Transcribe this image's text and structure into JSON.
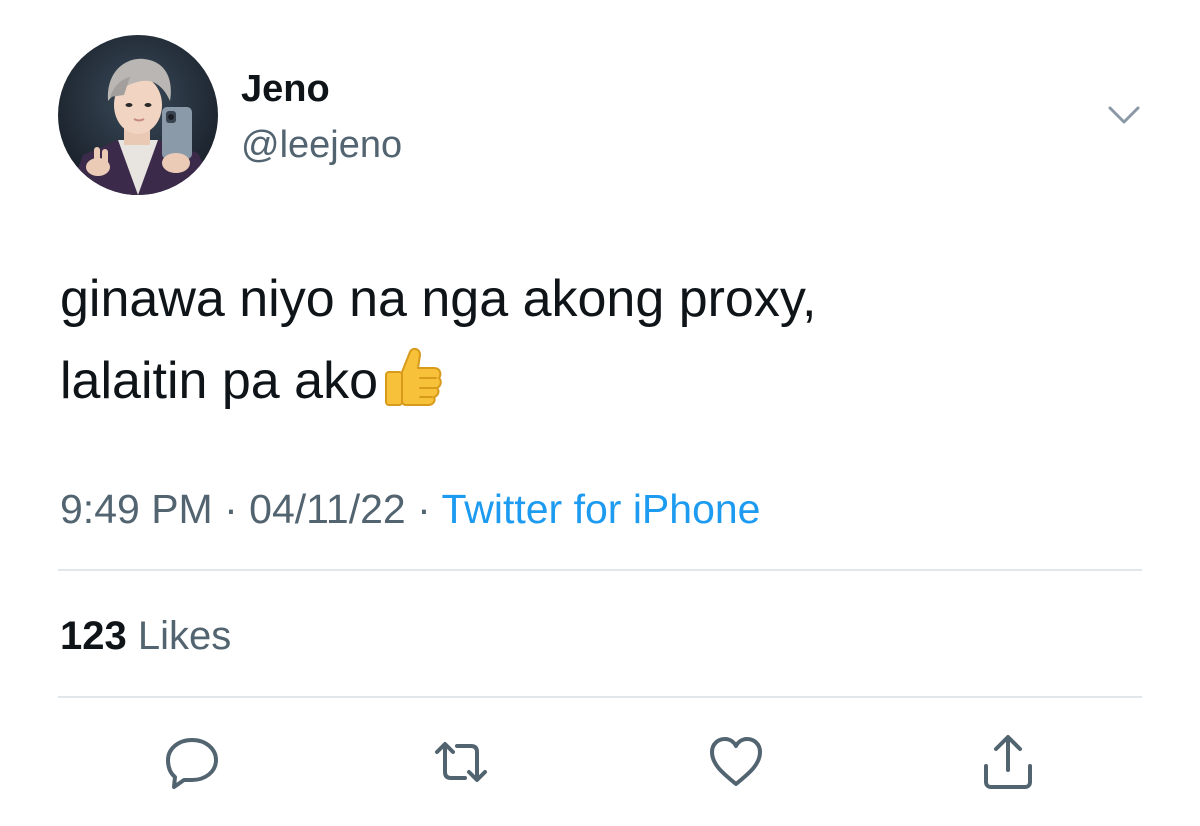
{
  "tweet": {
    "author": {
      "display_name": "Jeno",
      "handle": "@leejeno"
    },
    "text_lines": [
      "ginawa niyo na nga akong proxy,",
      "lalaitin pa ako"
    ],
    "emoji": "thumbs-up",
    "timestamp": "9:49 PM",
    "date": "04/11/22",
    "separator": "·",
    "source": "Twitter for iPhone",
    "likes": {
      "count": "123",
      "label": "Likes"
    },
    "actions": [
      "reply",
      "retweet",
      "like",
      "share"
    ],
    "colors": {
      "text": "#0f1419",
      "secondary": "#536471",
      "link": "#1d9bf0",
      "divider": "#e1e6ea",
      "icon": "#536471"
    }
  }
}
